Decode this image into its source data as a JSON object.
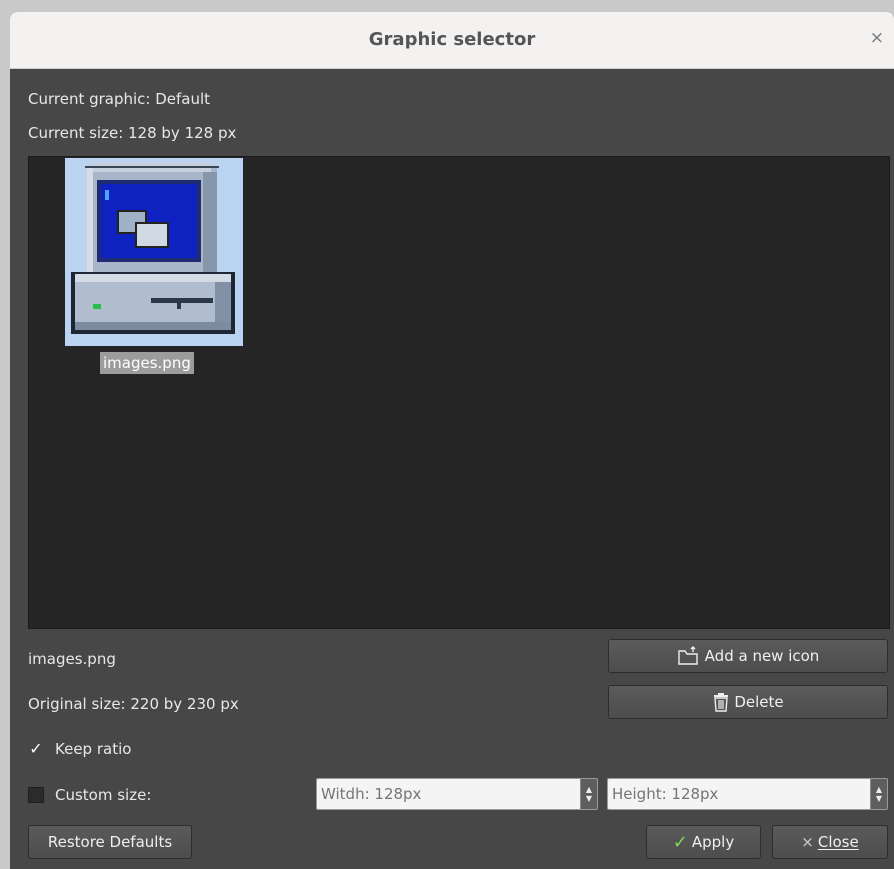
{
  "dialog": {
    "title": "Graphic selector",
    "close_glyph": "×"
  },
  "info": {
    "current_graphic": "Current graphic: Default",
    "current_size": "Current size: 128 by 128 px"
  },
  "icons": [
    {
      "filename": "images.png",
      "selected": true,
      "icon": "computer-icon"
    }
  ],
  "details": {
    "filename": "images.png",
    "original_size": "Original size: 220 by 230 px"
  },
  "options": {
    "keep_ratio": {
      "label": "Keep ratio",
      "checked": true
    },
    "custom_size": {
      "label": "Custom size:",
      "checked": false
    },
    "width_placeholder": "Witdh: 128px",
    "height_placeholder": "Height: 128px"
  },
  "buttons": {
    "add_icon": "Add a new icon",
    "delete": "Delete",
    "restore": "Restore Defaults",
    "apply": "Apply",
    "close": "Close"
  },
  "colors": {
    "dialog_bg": "#474747",
    "view_bg": "#252525",
    "selection": "#b9d3f0",
    "apply_check": "#7fd85a"
  }
}
